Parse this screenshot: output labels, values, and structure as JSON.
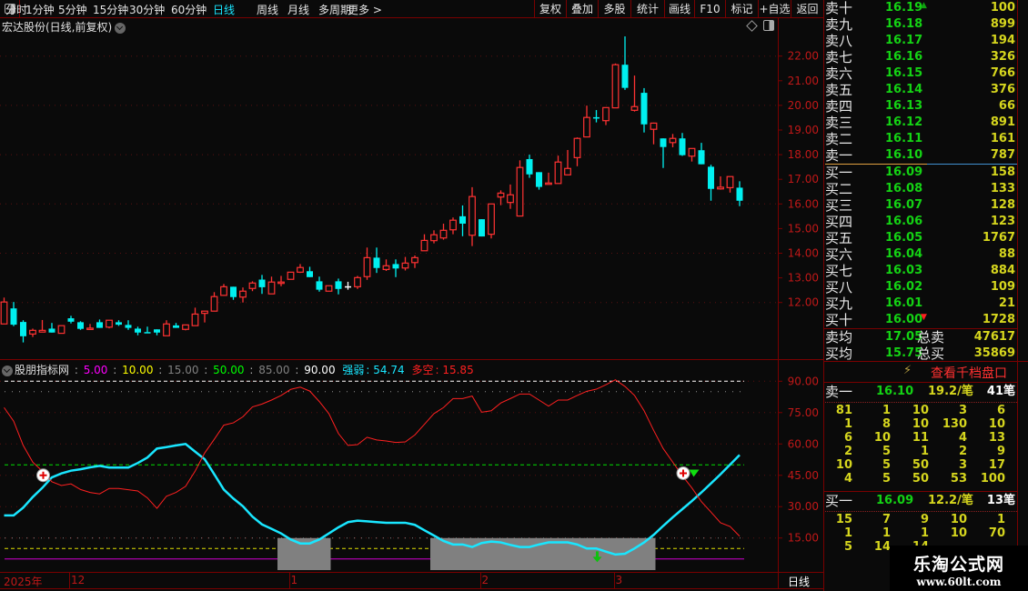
{
  "toolbar": {
    "periods": [
      "分时",
      "1分钟",
      "5分钟",
      "15分钟",
      "30分钟",
      "60分钟",
      "日线",
      "周线",
      "月线",
      "多周期",
      "更多 >"
    ],
    "active_period": "日线",
    "buttons": [
      "复权",
      "叠加",
      "多股",
      "统计",
      "画线",
      "F10",
      "标记",
      "+自选",
      "返回"
    ]
  },
  "chart_title": "宏达股份(日线,前复权)",
  "colors": {
    "up": "#ff3232",
    "down": "#00f0f0",
    "grid": "#7a0000",
    "axis_text": "#c01818",
    "strength": "#19e6ff",
    "longshort": "#ff2020"
  },
  "indicator": {
    "name": "股朋指标网",
    "params": [
      {
        "label": "5.00",
        "color": "#ff00ff"
      },
      {
        "label": "10.00",
        "color": "#ffff00"
      },
      {
        "label": "15.00",
        "color": "#808080"
      },
      {
        "label": "50.00",
        "color": "#00ff00"
      },
      {
        "label": "85.00",
        "color": "#808080"
      },
      {
        "label": "90.00",
        "color": "#ffffff"
      }
    ],
    "strength_label": "强弱",
    "strength_value": "54.74",
    "longshort_label": "多空",
    "longshort_value": "15.85"
  },
  "chart_data": [
    {
      "type": "candlestick",
      "ylim": [
        10.3,
        22.9
      ],
      "y_ticks": [
        "22.00",
        "21.00",
        "20.00",
        "19.00",
        "18.00",
        "17.00",
        "16.00",
        "15.00",
        "14.00",
        "13.00",
        "12.00"
      ],
      "ohlc": [
        [
          11.13,
          12.2,
          11.13,
          12.02
        ],
        [
          11.76,
          12.02,
          11.04,
          11.1
        ],
        [
          11.21,
          11.28,
          10.38,
          10.63
        ],
        [
          10.72,
          10.94,
          10.6,
          10.87
        ],
        [
          10.8,
          11.29,
          10.8,
          10.87
        ],
        [
          10.94,
          11.17,
          10.78,
          10.78
        ],
        [
          10.75,
          11.06,
          10.75,
          11.06
        ],
        [
          11.36,
          11.46,
          11.15,
          11.22
        ],
        [
          11.2,
          11.24,
          10.89,
          10.93
        ],
        [
          10.91,
          11.13,
          10.91,
          10.96
        ],
        [
          11.2,
          11.31,
          10.97,
          10.97
        ],
        [
          11.0,
          11.28,
          10.95,
          11.28
        ],
        [
          11.2,
          11.28,
          11.05,
          11.1
        ],
        [
          11.09,
          11.28,
          10.89,
          10.97
        ],
        [
          10.94,
          11.02,
          10.67,
          10.78
        ],
        [
          10.8,
          11.02,
          10.78,
          10.78
        ],
        [
          10.91,
          10.91,
          10.67,
          10.78
        ],
        [
          10.65,
          11.28,
          10.65,
          11.13
        ],
        [
          11.07,
          11.17,
          10.97,
          10.97
        ],
        [
          10.91,
          11.09,
          10.87,
          11.09
        ],
        [
          11.06,
          11.79,
          11.06,
          11.53
        ],
        [
          11.56,
          11.65,
          11.19,
          11.65
        ],
        [
          11.65,
          12.42,
          11.65,
          12.24
        ],
        [
          12.29,
          12.75,
          12.27,
          12.64
        ],
        [
          12.64,
          12.64,
          12.11,
          12.22
        ],
        [
          12.22,
          12.61,
          12.0,
          12.46
        ],
        [
          12.57,
          12.86,
          12.46,
          12.79
        ],
        [
          12.93,
          13.12,
          12.35,
          12.62
        ],
        [
          12.35,
          13.05,
          12.35,
          12.83
        ],
        [
          12.79,
          13.08,
          12.66,
          12.83
        ],
        [
          12.94,
          13.23,
          12.94,
          13.23
        ],
        [
          13.23,
          13.56,
          13.2,
          13.42
        ],
        [
          13.27,
          13.45,
          13.03,
          13.03
        ],
        [
          12.86,
          13.05,
          12.44,
          12.52
        ],
        [
          12.46,
          12.68,
          12.46,
          12.68
        ],
        [
          12.86,
          12.97,
          12.33,
          12.55
        ],
        [
          12.66,
          12.84,
          12.52,
          12.66
        ],
        [
          12.64,
          13.08,
          12.55,
          13.01
        ],
        [
          13.05,
          14.23,
          12.92,
          13.82
        ],
        [
          13.82,
          14.23,
          13.2,
          13.4
        ],
        [
          13.34,
          13.75,
          13.28,
          13.49
        ],
        [
          13.56,
          13.75,
          13.03,
          13.38
        ],
        [
          13.4,
          13.85,
          13.3,
          13.6
        ],
        [
          13.62,
          13.91,
          13.4,
          13.82
        ],
        [
          14.1,
          14.77,
          14.1,
          14.52
        ],
        [
          14.51,
          14.93,
          14.4,
          14.75
        ],
        [
          14.62,
          15.2,
          14.55,
          14.93
        ],
        [
          14.95,
          15.45,
          14.77,
          15.34
        ],
        [
          15.5,
          15.94,
          14.69,
          15.2
        ],
        [
          14.73,
          16.68,
          14.29,
          16.3
        ],
        [
          15.38,
          15.38,
          14.68,
          14.68
        ],
        [
          14.77,
          16.0,
          14.6,
          16.0
        ],
        [
          16.28,
          16.55,
          15.95,
          16.44
        ],
        [
          16.06,
          16.79,
          15.8,
          16.37
        ],
        [
          15.51,
          17.77,
          15.51,
          17.48
        ],
        [
          17.82,
          18.0,
          17.06,
          17.2
        ],
        [
          17.29,
          17.29,
          16.58,
          16.69
        ],
        [
          16.8,
          17.27,
          16.8,
          16.85
        ],
        [
          16.83,
          17.96,
          16.83,
          17.7
        ],
        [
          17.18,
          18.19,
          17.18,
          17.44
        ],
        [
          17.88,
          18.7,
          17.53,
          18.66
        ],
        [
          18.72,
          19.99,
          18.72,
          19.51
        ],
        [
          19.52,
          19.81,
          19.31,
          19.48
        ],
        [
          19.38,
          19.91,
          19.2,
          19.91
        ],
        [
          19.9,
          21.7,
          19.9,
          21.65
        ],
        [
          21.65,
          22.8,
          20.63,
          20.71
        ],
        [
          19.8,
          21.21,
          19.75,
          19.95
        ],
        [
          20.51,
          20.7,
          18.9,
          19.23
        ],
        [
          19.03,
          19.3,
          18.42,
          19.28
        ],
        [
          18.66,
          18.66,
          17.46,
          18.31
        ],
        [
          18.49,
          18.84,
          18.3,
          18.66
        ],
        [
          18.66,
          18.88,
          17.95,
          17.98
        ],
        [
          17.94,
          18.25,
          17.72,
          18.25
        ],
        [
          18.18,
          18.48,
          17.61,
          17.61
        ],
        [
          17.51,
          17.59,
          16.13,
          16.61
        ],
        [
          16.61,
          17.12,
          16.58,
          16.68
        ],
        [
          16.66,
          17.11,
          16.46,
          17.11
        ],
        [
          16.66,
          16.92,
          15.91,
          16.13
        ]
      ]
    },
    {
      "type": "line",
      "ylim": [
        0,
        95
      ],
      "y_ticks": [
        "90.00",
        "75.00",
        "60.00",
        "45.00",
        "30.00",
        "15.00"
      ],
      "reference_lines": [
        90,
        85,
        50,
        15,
        10,
        5
      ],
      "series": [
        {
          "name": "强弱",
          "color": "#19e6ff",
          "values": [
            25.8,
            25.8,
            29.5,
            34.6,
            39,
            44,
            45.9,
            47.2,
            47.9,
            48.8,
            49.5,
            48.7,
            48.7,
            48.7,
            50.9,
            53.5,
            57.8,
            58.5,
            59.3,
            60,
            56.3,
            52.7,
            45.5,
            38.2,
            33.9,
            30.2,
            25.2,
            21.5,
            19.4,
            17.2,
            14.3,
            12.4,
            12.4,
            14.3,
            17.2,
            20.1,
            22.6,
            23.3,
            23,
            22.6,
            22.3,
            22.3,
            22.3,
            21.3,
            18.7,
            16.2,
            13.6,
            11.9,
            11.9,
            10.7,
            12.6,
            13.3,
            12.9,
            11.7,
            10.7,
            10.7,
            11.9,
            12.9,
            12.9,
            12.9,
            11.9,
            10,
            10,
            8.5,
            7.1,
            7.5,
            10,
            12.9,
            16.5,
            20.8,
            24.9,
            28.8,
            32.7,
            36.8,
            41.1,
            45.5,
            50.1,
            54.74
          ]
        },
        {
          "name": "多空",
          "color": "#ff2020",
          "values": [
            77.4,
            70.9,
            59.3,
            51.3,
            47,
            41.9,
            40.1,
            40.9,
            38.2,
            36.8,
            36.1,
            38.7,
            38.7,
            38.1,
            37.5,
            34.2,
            29.2,
            35,
            36.8,
            39.7,
            47,
            55.7,
            62.2,
            69,
            70.1,
            73,
            77.7,
            79.1,
            81,
            83.2,
            86.1,
            87.2,
            85.3,
            80.3,
            74.5,
            65,
            59.3,
            59.7,
            63.2,
            61.9,
            61.4,
            60.7,
            61,
            64.3,
            69.4,
            74.5,
            77.4,
            81.7,
            81.7,
            82.9,
            75.2,
            75.9,
            79.6,
            81.7,
            83.9,
            83.9,
            81,
            78.1,
            81,
            81,
            83.2,
            85.2,
            86.2,
            88.3,
            90.7,
            87.5,
            83.2,
            75.9,
            66.5,
            57.8,
            51.3,
            44.8,
            39,
            32.4,
            27.4,
            22.3,
            20.5,
            15.85
          ]
        }
      ],
      "shaded_ranges": [
        [
          29,
          34
        ],
        [
          45,
          68
        ]
      ],
      "buy_markers": [
        {
          "bar": 4,
          "value": 45
        },
        {
          "bar": 71,
          "value": 46
        }
      ],
      "sell_triangle_markers": [
        {
          "bar": 72,
          "value": 46
        }
      ],
      "down_arrow_markers": [
        {
          "bar": 62,
          "value": 6
        }
      ]
    }
  ],
  "x_axis": {
    "year": "2025年",
    "months": [
      {
        "label": "12",
        "bar": 7
      },
      {
        "label": "1",
        "bar": 30
      },
      {
        "label": "2",
        "bar": 50
      },
      {
        "label": "3",
        "bar": 64
      }
    ],
    "period_label": "日线"
  },
  "orderbook": {
    "asks": [
      {
        "label": "卖十",
        "price": "16.19",
        "vol": "100",
        "mark": "up"
      },
      {
        "label": "卖九",
        "price": "16.18",
        "vol": "899"
      },
      {
        "label": "卖八",
        "price": "16.17",
        "vol": "194"
      },
      {
        "label": "卖七",
        "price": "16.16",
        "vol": "326"
      },
      {
        "label": "卖六",
        "price": "16.15",
        "vol": "766"
      },
      {
        "label": "卖五",
        "price": "16.14",
        "vol": "376"
      },
      {
        "label": "卖四",
        "price": "16.13",
        "vol": "66"
      },
      {
        "label": "卖三",
        "price": "16.12",
        "vol": "891"
      },
      {
        "label": "卖二",
        "price": "16.11",
        "vol": "161"
      },
      {
        "label": "卖一",
        "price": "16.10",
        "vol": "787"
      }
    ],
    "bids": [
      {
        "label": "买一",
        "price": "16.09",
        "vol": "158"
      },
      {
        "label": "买二",
        "price": "16.08",
        "vol": "133"
      },
      {
        "label": "买三",
        "price": "16.07",
        "vol": "128"
      },
      {
        "label": "买四",
        "price": "16.06",
        "vol": "123"
      },
      {
        "label": "买五",
        "price": "16.05",
        "vol": "1767"
      },
      {
        "label": "买六",
        "price": "16.04",
        "vol": "88"
      },
      {
        "label": "买七",
        "price": "16.03",
        "vol": "884"
      },
      {
        "label": "买八",
        "price": "16.02",
        "vol": "109"
      },
      {
        "label": "买九",
        "price": "16.01",
        "vol": "21"
      },
      {
        "label": "买十",
        "price": "16.00",
        "vol": "1728",
        "mark": "down"
      }
    ],
    "summary": [
      {
        "label": "卖均",
        "price": "17.05",
        "label2": "总卖",
        "vol": "47617"
      },
      {
        "label": "买均",
        "price": "15.75",
        "label2": "总买",
        "vol": "35869"
      }
    ],
    "thousand_link": "查看千档盘口",
    "ask1_detail": {
      "label": "卖一",
      "price": "16.10",
      "avg": "19.2/笔",
      "count": "41笔",
      "orders": [
        [
          "81",
          "1",
          "10",
          "3",
          "6"
        ],
        [
          "1",
          "8",
          "10",
          "130",
          "10"
        ],
        [
          "6",
          "10",
          "11",
          "4",
          "13"
        ],
        [
          "2",
          "5",
          "1",
          "2",
          "9"
        ],
        [
          "10",
          "5",
          "50",
          "3",
          "17"
        ],
        [
          "4",
          "5",
          "50",
          "53",
          "100"
        ]
      ]
    },
    "bid1_detail": {
      "label": "买一",
      "price": "16.09",
      "avg": "12.2/笔",
      "count": "13笔",
      "orders": [
        [
          "15",
          "7",
          "9",
          "10",
          "1"
        ],
        [
          "1",
          "1",
          "1",
          "10",
          "70"
        ],
        [
          "5",
          "14",
          "14",
          "",
          ""
        ]
      ]
    }
  },
  "watermark": {
    "name": "乐淘公式网",
    "url": "www.60lt.com"
  }
}
